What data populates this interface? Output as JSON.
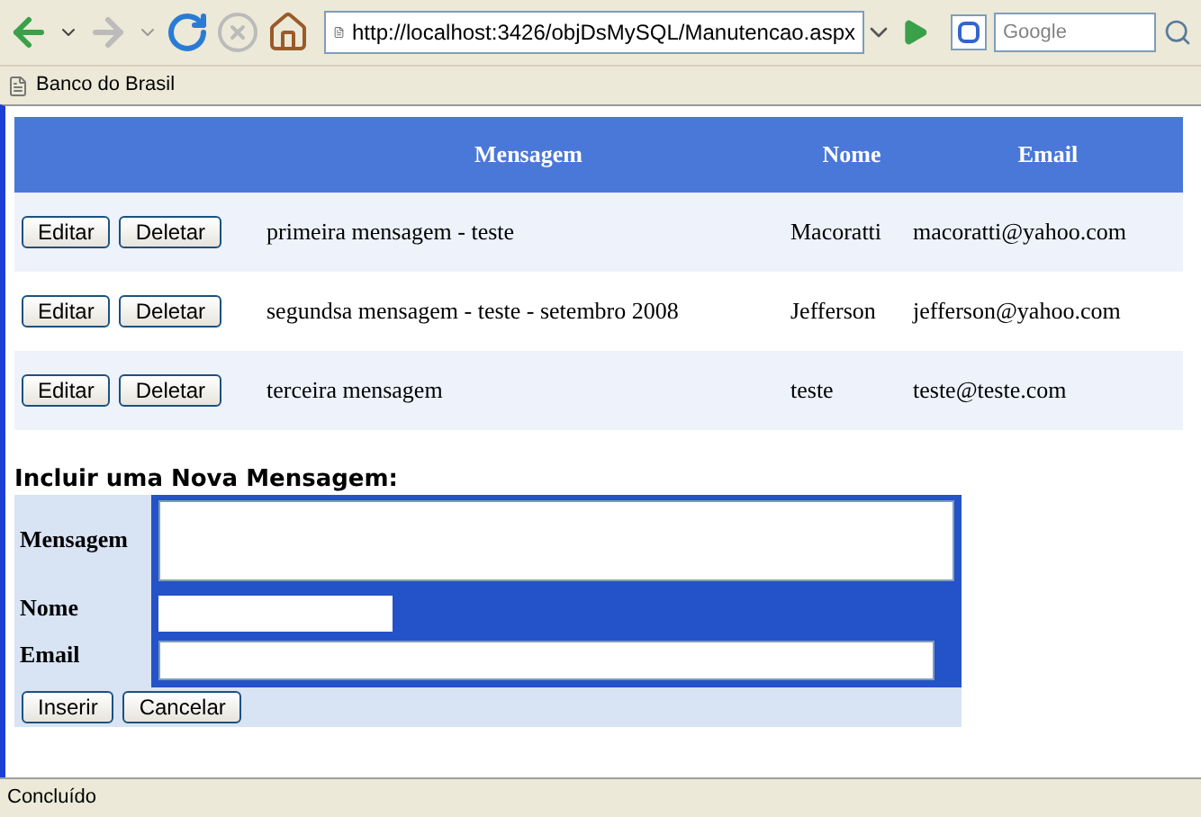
{
  "browser": {
    "url": "http://localhost:3426/objDsMySQL/Manutencao.aspx",
    "search": {
      "placeholder": "Google"
    },
    "bookmarks": [
      "Banco do Brasil"
    ]
  },
  "table": {
    "columns": [
      "Mensagem",
      "Nome",
      "Email"
    ],
    "rows": [
      {
        "buttons": [
          "Editar",
          "Deletar"
        ],
        "mensagem": "primeira mensagem - teste",
        "nome": "Macoratti",
        "email": "macoratti@yahoo.com"
      },
      {
        "buttons": [
          "Editar",
          "Deletar"
        ],
        "mensagem": "segundsa mensagem - teste - setembro 2008",
        "nome": "Jefferson",
        "email": "jefferson@yahoo.com"
      },
      {
        "buttons": [
          "Editar",
          "Deletar"
        ],
        "mensagem": "terceira mensagem",
        "nome": "teste",
        "email": "teste@teste.com"
      }
    ]
  },
  "form": {
    "title": "Incluir uma Nova Mensagem:",
    "fields": [
      {
        "label": "Mensagem",
        "kind": "textarea"
      },
      {
        "label": "Nome",
        "kind": "short"
      },
      {
        "label": "Email",
        "kind": "long"
      }
    ],
    "buttons": [
      "Inserir",
      "Cancelar"
    ]
  },
  "status_bar": "Concluído"
}
